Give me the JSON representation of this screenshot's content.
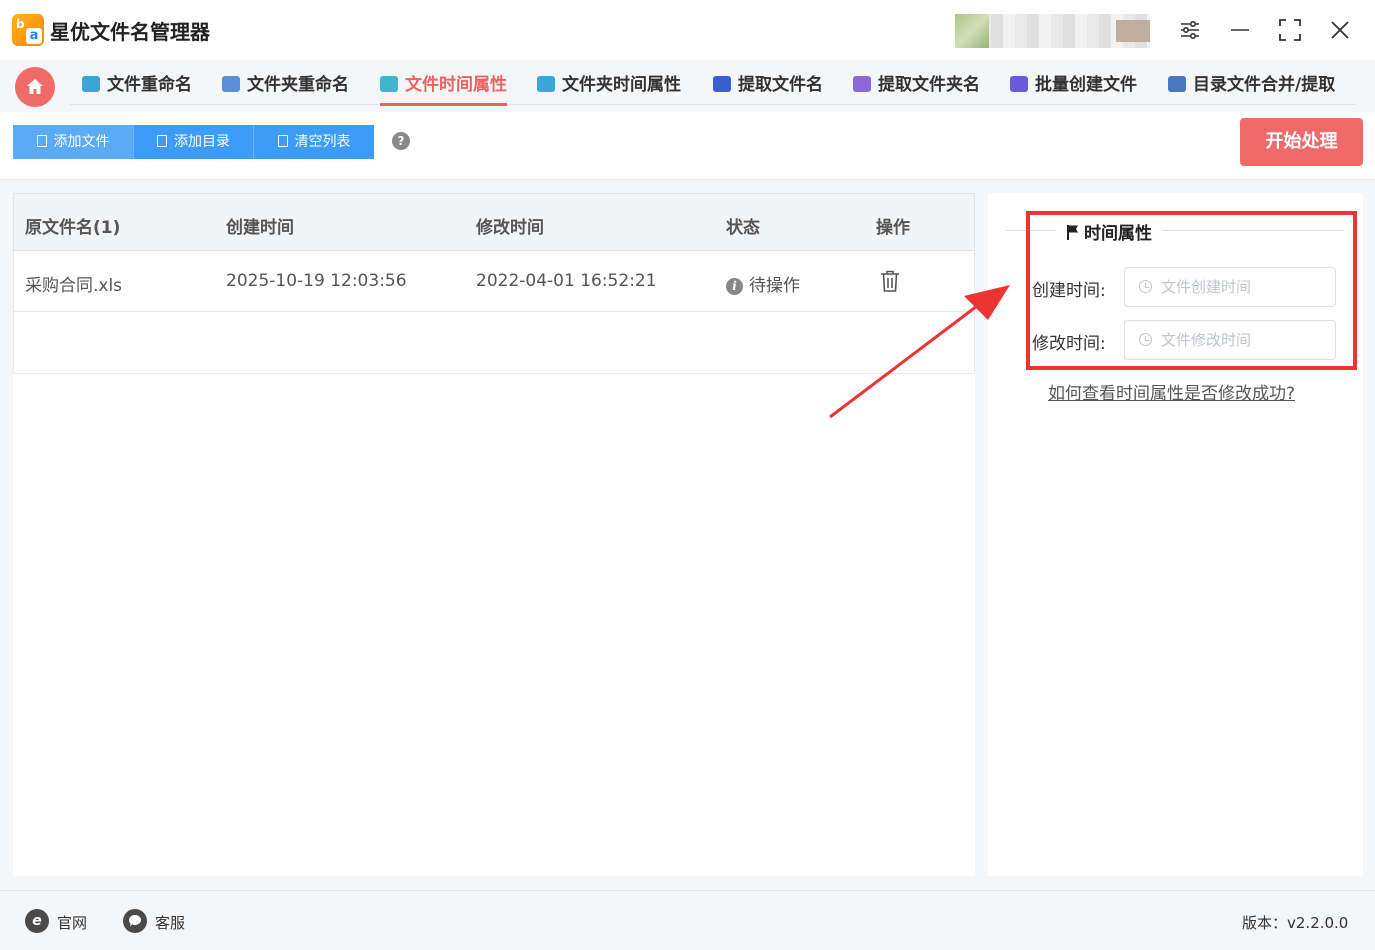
{
  "app": {
    "title": "星优文件名管理器"
  },
  "tabs": [
    {
      "label": "文件重命名",
      "color": "#3aa7d8"
    },
    {
      "label": "文件夹重命名",
      "color": "#5a8fd8"
    },
    {
      "label": "文件时间属性",
      "color": "#43b4d0"
    },
    {
      "label": "文件夹时间属性",
      "color": "#3aa7d8"
    },
    {
      "label": "提取文件名",
      "color": "#3b5fd0"
    },
    {
      "label": "提取文件夹名",
      "color": "#8a6ad8"
    },
    {
      "label": "批量创建文件",
      "color": "#6a5ae0"
    },
    {
      "label": "目录文件合并/提取",
      "color": "#4a78c0"
    }
  ],
  "active_tab": "文件时间属性",
  "toolbar": {
    "add_file": "添加文件",
    "add_dir": "添加目录",
    "clear_list": "清空列表",
    "help": "?",
    "start": "开始处理"
  },
  "table": {
    "headers": {
      "name": "原文件名(1)",
      "created": "创建时间",
      "modified": "修改时间",
      "status": "状态",
      "action": "操作"
    },
    "rows": [
      {
        "name": "采购合同.xls",
        "created": "2025-10-19 12:03:56",
        "modified": "2022-04-01 16:52:21",
        "status": "待操作"
      }
    ]
  },
  "panel": {
    "legend": "时间属性",
    "created_label": "创建时间:",
    "created_placeholder": "文件创建时间",
    "modified_label": "修改时间:",
    "modified_placeholder": "文件修改时间",
    "help_link": "如何查看时间属性是否修改成功?"
  },
  "footer": {
    "website": "官网",
    "support": "客服",
    "version": "版本：v2.2.0.0"
  },
  "colors": {
    "accent": "#f06a6a",
    "primary": "#3d9cf6",
    "annotation": "#ee3333"
  }
}
